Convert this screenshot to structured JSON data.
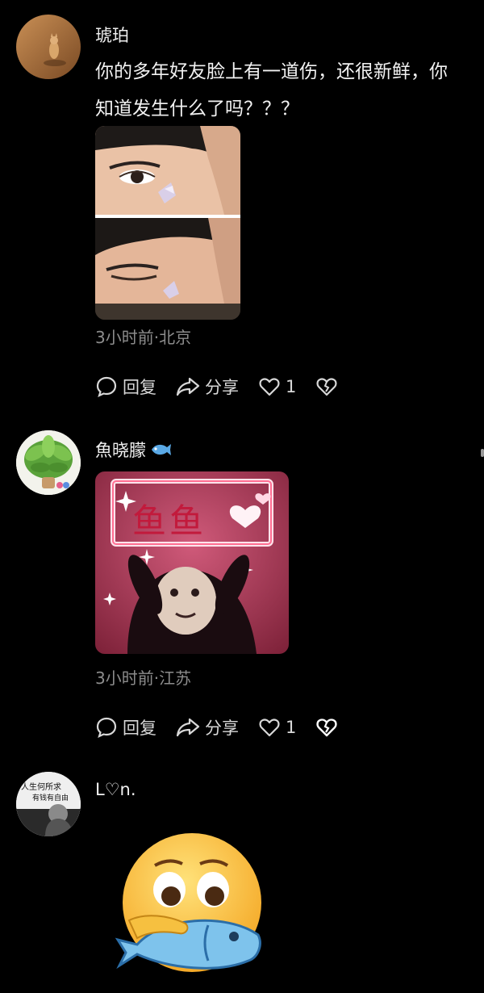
{
  "comments": [
    {
      "username": "琥珀",
      "text_lines": [
        "你的多年好友脸上有一道伤，还很新鲜，你",
        "知道发生什么了吗？？？"
      ],
      "meta": "3小时前·北京",
      "reply_label": "回复",
      "share_label": "分享",
      "like_count": "1"
    },
    {
      "username": "魚晓朦",
      "image_text": "鱼鱼",
      "meta": "3小时前·江苏",
      "reply_label": "回复",
      "share_label": "分享",
      "like_count": "1"
    },
    {
      "username": "L♡n.",
      "avatar_text": [
        "人生何所求",
        "有钱有自由"
      ]
    }
  ],
  "colors": {
    "background": "#000000",
    "text": "#f2f2f2",
    "meta": "#8c8c8c",
    "fish_badge": "#5aa9e6"
  }
}
